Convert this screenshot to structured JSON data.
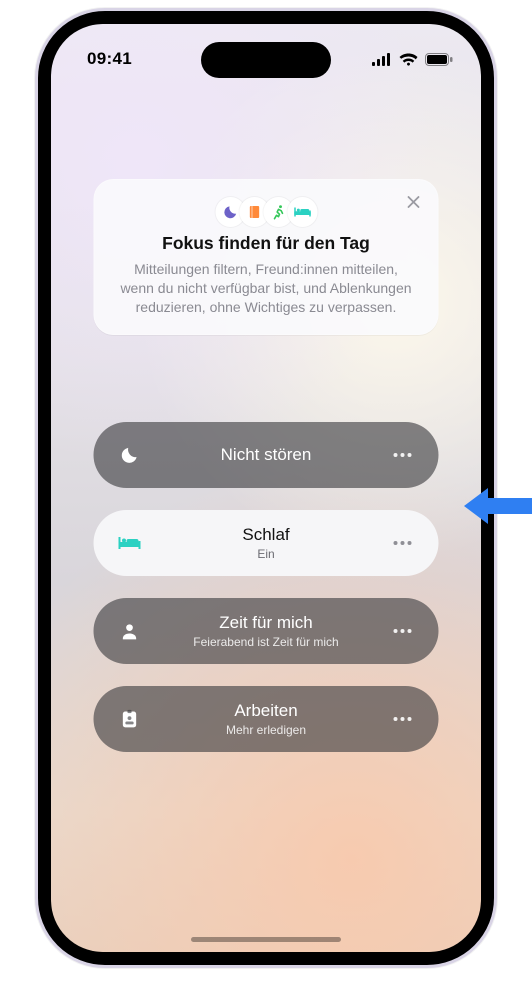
{
  "status": {
    "time": "09:41"
  },
  "colors": {
    "moon": "#6d62c8",
    "book": "#ff8a3a",
    "runner": "#34c759",
    "bed": "#2bd1c2",
    "arrow": "#2f7ff2"
  },
  "hero": {
    "title": "Fokus finden für den Tag",
    "description": "Mitteilungen filtern, Freund:innen mitteilen, wenn du nicht verfügbar bist, und Ablenkungen reduzieren, ohne Wichtiges zu verpassen.",
    "icon_names": [
      "moon-icon",
      "book-icon",
      "runner-icon",
      "bed-icon"
    ]
  },
  "pills": [
    {
      "icon": "moon",
      "title": "Nicht stören",
      "subtitle": "",
      "active": false
    },
    {
      "icon": "bed",
      "title": "Schlaf",
      "subtitle": "Ein",
      "active": true
    },
    {
      "icon": "person",
      "title": "Zeit für mich",
      "subtitle": "Feierabend ist Zeit für mich",
      "active": false
    },
    {
      "icon": "badge",
      "title": "Arbeiten",
      "subtitle": "Mehr erledigen",
      "active": false
    }
  ]
}
